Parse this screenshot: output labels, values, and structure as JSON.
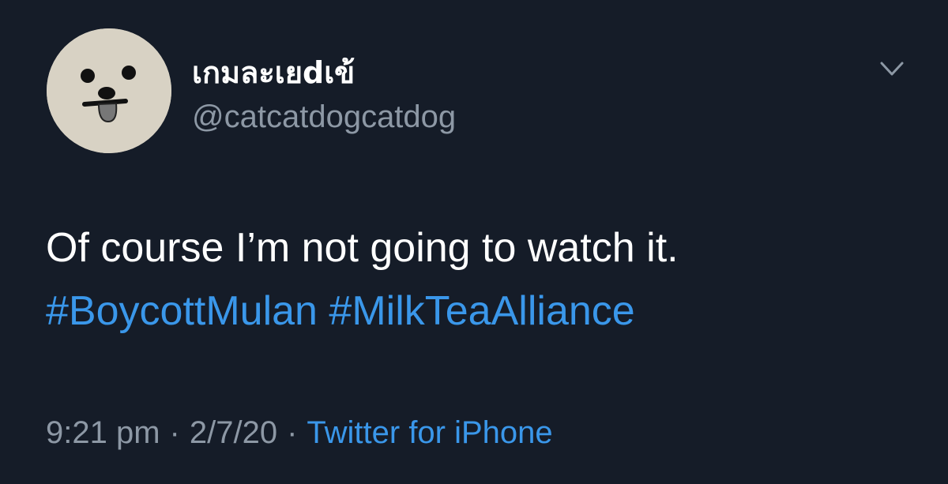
{
  "tweet": {
    "author": {
      "display_name": "เกมละเยdเข้",
      "handle": "@catcatdogcatdog",
      "avatar_icon": "dog-face-avatar"
    },
    "text": "Of course I’m not going to watch it.",
    "hashtags": [
      "#BoycottMulan",
      "#MilkTeaAlliance"
    ],
    "time": "9:21 pm",
    "date": "2/7/20",
    "separator": "·",
    "source": "Twitter for iPhone"
  },
  "colors": {
    "background": "#151c28",
    "primary_text": "#ffffff",
    "secondary_text": "#8d98a5",
    "link": "#3a97ea"
  },
  "icons": {
    "menu": "chevron-down-icon"
  }
}
